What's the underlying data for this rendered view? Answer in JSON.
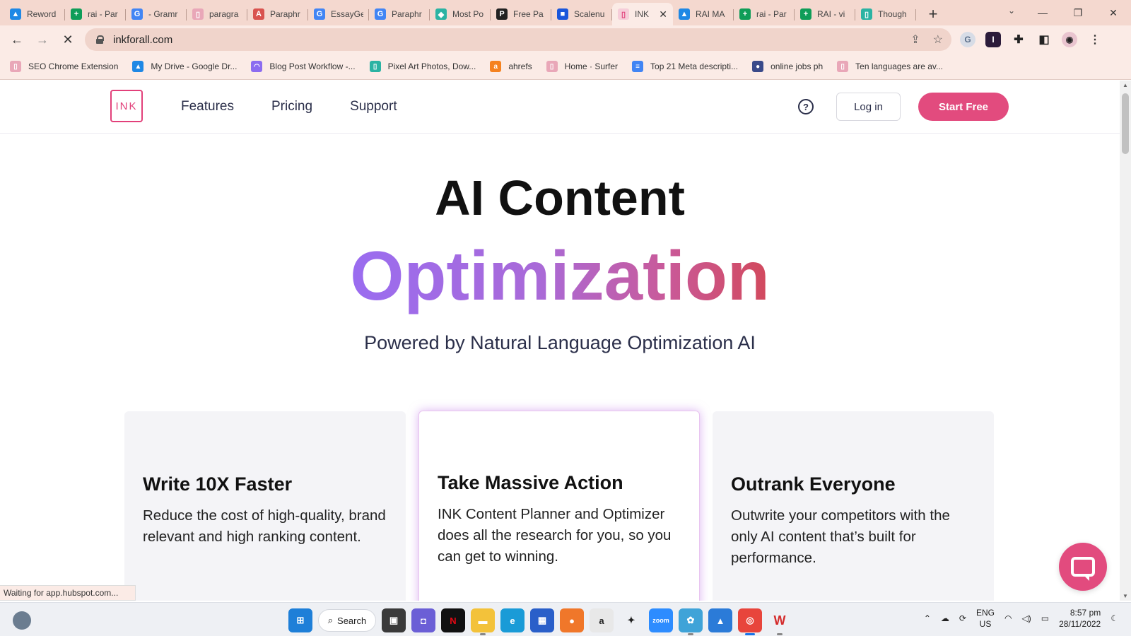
{
  "browser": {
    "tabs": [
      {
        "title": "Reword",
        "favicon": "drive-icon",
        "color": "#1e88e5"
      },
      {
        "title": "rai - Par",
        "favicon": "sheets-icon",
        "color": "#0f9d58"
      },
      {
        "title": "- Gramr",
        "favicon": "google-icon",
        "color": "#4285f4"
      },
      {
        "title": "paragra",
        "favicon": "page-icon",
        "color": "#e9a7b8"
      },
      {
        "title": "Paraphr",
        "favicon": "quillbot-icon",
        "color": "#d9534f"
      },
      {
        "title": "EssayGe",
        "favicon": "google-icon",
        "color": "#4285f4"
      },
      {
        "title": "Paraphr",
        "favicon": "google-icon",
        "color": "#4285f4"
      },
      {
        "title": "Most Po",
        "favicon": "bookmark-icon",
        "color": "#2bb3a3"
      },
      {
        "title": "Free Pa",
        "favicon": "p-icon",
        "color": "#222222"
      },
      {
        "title": "Scalenu",
        "favicon": "scalenut-icon",
        "color": "#1a56db"
      },
      {
        "title": "INK",
        "favicon": "ink-icon",
        "color": "#e2407a"
      },
      {
        "title": "RAI MA",
        "favicon": "drive-icon",
        "color": "#1e88e5"
      },
      {
        "title": "rai - Par",
        "favicon": "sheets-icon",
        "color": "#0f9d58"
      },
      {
        "title": "RAI - vi",
        "favicon": "sheets-icon",
        "color": "#0f9d58"
      },
      {
        "title": "Though",
        "favicon": "page-icon",
        "color": "#2bb3a3"
      }
    ],
    "active_tab_index": 10,
    "url": "inkforall.com",
    "bookmarks": [
      {
        "label": "SEO Chrome Extension",
        "color": "#e9a7b8"
      },
      {
        "label": "My Drive - Google Dr...",
        "color": "#1e88e5"
      },
      {
        "label": "Blog Post Workflow -...",
        "color": "#8c6cf0"
      },
      {
        "label": "Pixel Art Photos, Dow...",
        "color": "#2bb3a3"
      },
      {
        "label": "ahrefs",
        "color": "#f58220"
      },
      {
        "label": "Home · Surfer",
        "color": "#e9a7b8"
      },
      {
        "label": "Top 21 Meta descripti...",
        "color": "#4285f4"
      },
      {
        "label": "online jobs ph",
        "color": "#3a4a8a"
      },
      {
        "label": "Ten languages are av...",
        "color": "#e9a7b8"
      }
    ],
    "status_text": "Waiting for app.hubspot.com..."
  },
  "site": {
    "logo_text": "INK",
    "nav": [
      "Features",
      "Pricing",
      "Support"
    ],
    "help_glyph": "?",
    "login_label": "Log in",
    "start_label": "Start Free",
    "accent": "#e24b7e",
    "hero_title": "AI Content",
    "hero_gradient_text": "Optimization",
    "hero_subtitle": "Powered by Natural Language Optimization AI",
    "cards": [
      {
        "title": "Write 10X Faster",
        "text": "Reduce the cost of high-quality, brand relevant and high ranking content."
      },
      {
        "title": "Take Massive Action",
        "text": "INK Content Planner and Optimizer does all the research for you, so you can get to winning."
      },
      {
        "title": "Outrank Everyone",
        "text": "Outwrite your competitors with the only AI content that’s built for performance."
      }
    ]
  },
  "taskbar": {
    "search_label": "Search",
    "lang_top": "ENG",
    "lang_bottom": "US",
    "time": "8:57 pm",
    "date": "28/11/2022"
  }
}
